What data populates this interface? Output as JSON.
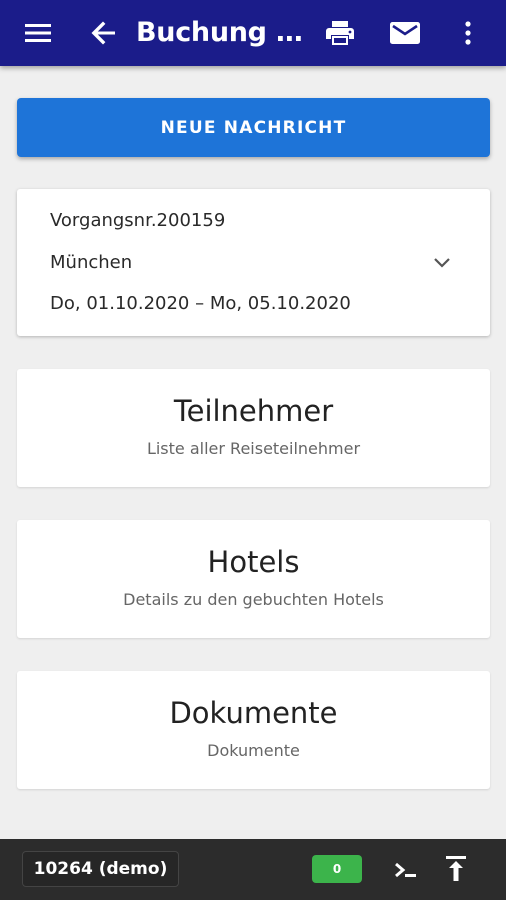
{
  "appbar": {
    "title": "Buchung (20...",
    "icons": [
      "menu-icon",
      "back-icon",
      "print-icon",
      "mail-icon",
      "more-vert-icon"
    ],
    "color": "#1b1c8a"
  },
  "new_message_button": {
    "label": "NEUE NACHRICHT",
    "color": "#1e74d8"
  },
  "booking": {
    "number": "Vorgangsnr.200159",
    "city": "München",
    "dates": "Do, 01.10.2020 – Mo, 05.10.2020"
  },
  "cards": [
    {
      "title": "Teilnehmer",
      "subtitle": "Liste aller Reiseteilnehmer"
    },
    {
      "title": "Hotels",
      "subtitle": "Details zu den gebuchten Hotels"
    },
    {
      "title": "Dokumente",
      "subtitle": "Dokumente"
    }
  ],
  "bottombar": {
    "user": "10264 (demo)",
    "count": "0",
    "count_color": "#3cb44b",
    "icons": [
      "terminal-icon",
      "upload-icon"
    ]
  }
}
